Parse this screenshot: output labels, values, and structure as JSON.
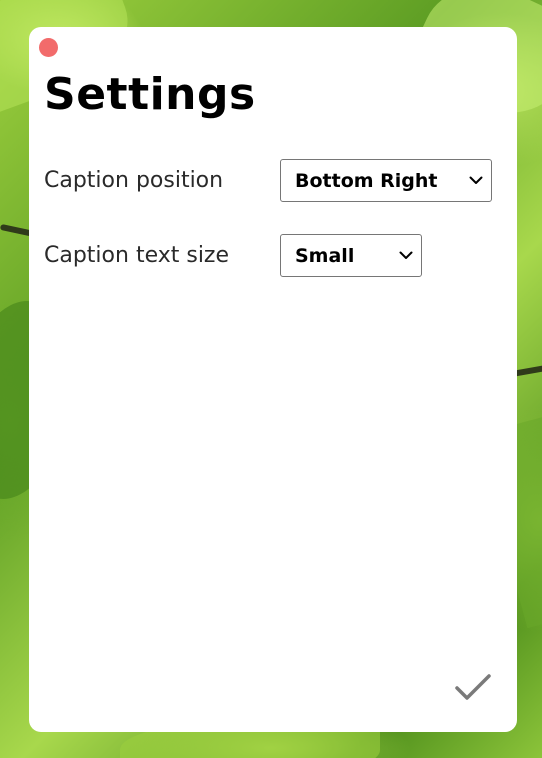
{
  "window": {
    "close_button_color": "#f26b6b"
  },
  "settings": {
    "title": "Settings",
    "caption_position": {
      "label": "Caption position",
      "selected": "Bottom Right"
    },
    "caption_text_size": {
      "label": "Caption text size",
      "selected": "Small"
    },
    "confirm_icon": "checkmark-icon"
  },
  "colors": {
    "panel_background": "#ffffff",
    "confirm_icon": "#7a7a7a"
  }
}
